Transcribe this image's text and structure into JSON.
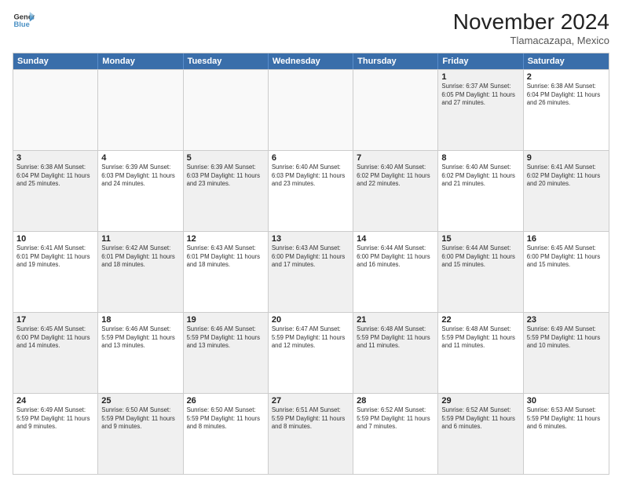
{
  "logo": {
    "line1": "General",
    "line2": "Blue",
    "icon": "▶"
  },
  "title": "November 2024",
  "location": "Tlamacazapa, Mexico",
  "header_days": [
    "Sunday",
    "Monday",
    "Tuesday",
    "Wednesday",
    "Thursday",
    "Friday",
    "Saturday"
  ],
  "weeks": [
    [
      {
        "day": "",
        "info": "",
        "empty": true
      },
      {
        "day": "",
        "info": "",
        "empty": true
      },
      {
        "day": "",
        "info": "",
        "empty": true
      },
      {
        "day": "",
        "info": "",
        "empty": true
      },
      {
        "day": "",
        "info": "",
        "empty": true
      },
      {
        "day": "1",
        "info": "Sunrise: 6:37 AM\nSunset: 6:05 PM\nDaylight: 11 hours and 27 minutes.",
        "shaded": true
      },
      {
        "day": "2",
        "info": "Sunrise: 6:38 AM\nSunset: 6:04 PM\nDaylight: 11 hours and 26 minutes.",
        "shaded": false
      }
    ],
    [
      {
        "day": "3",
        "info": "Sunrise: 6:38 AM\nSunset: 6:04 PM\nDaylight: 11 hours and 25 minutes.",
        "shaded": true
      },
      {
        "day": "4",
        "info": "Sunrise: 6:39 AM\nSunset: 6:03 PM\nDaylight: 11 hours and 24 minutes.",
        "shaded": false
      },
      {
        "day": "5",
        "info": "Sunrise: 6:39 AM\nSunset: 6:03 PM\nDaylight: 11 hours and 23 minutes.",
        "shaded": true
      },
      {
        "day": "6",
        "info": "Sunrise: 6:40 AM\nSunset: 6:03 PM\nDaylight: 11 hours and 23 minutes.",
        "shaded": false
      },
      {
        "day": "7",
        "info": "Sunrise: 6:40 AM\nSunset: 6:02 PM\nDaylight: 11 hours and 22 minutes.",
        "shaded": true
      },
      {
        "day": "8",
        "info": "Sunrise: 6:40 AM\nSunset: 6:02 PM\nDaylight: 11 hours and 21 minutes.",
        "shaded": false
      },
      {
        "day": "9",
        "info": "Sunrise: 6:41 AM\nSunset: 6:02 PM\nDaylight: 11 hours and 20 minutes.",
        "shaded": true
      }
    ],
    [
      {
        "day": "10",
        "info": "Sunrise: 6:41 AM\nSunset: 6:01 PM\nDaylight: 11 hours and 19 minutes.",
        "shaded": false
      },
      {
        "day": "11",
        "info": "Sunrise: 6:42 AM\nSunset: 6:01 PM\nDaylight: 11 hours and 18 minutes.",
        "shaded": true
      },
      {
        "day": "12",
        "info": "Sunrise: 6:43 AM\nSunset: 6:01 PM\nDaylight: 11 hours and 18 minutes.",
        "shaded": false
      },
      {
        "day": "13",
        "info": "Sunrise: 6:43 AM\nSunset: 6:00 PM\nDaylight: 11 hours and 17 minutes.",
        "shaded": true
      },
      {
        "day": "14",
        "info": "Sunrise: 6:44 AM\nSunset: 6:00 PM\nDaylight: 11 hours and 16 minutes.",
        "shaded": false
      },
      {
        "day": "15",
        "info": "Sunrise: 6:44 AM\nSunset: 6:00 PM\nDaylight: 11 hours and 15 minutes.",
        "shaded": true
      },
      {
        "day": "16",
        "info": "Sunrise: 6:45 AM\nSunset: 6:00 PM\nDaylight: 11 hours and 15 minutes.",
        "shaded": false
      }
    ],
    [
      {
        "day": "17",
        "info": "Sunrise: 6:45 AM\nSunset: 6:00 PM\nDaylight: 11 hours and 14 minutes.",
        "shaded": true
      },
      {
        "day": "18",
        "info": "Sunrise: 6:46 AM\nSunset: 5:59 PM\nDaylight: 11 hours and 13 minutes.",
        "shaded": false
      },
      {
        "day": "19",
        "info": "Sunrise: 6:46 AM\nSunset: 5:59 PM\nDaylight: 11 hours and 13 minutes.",
        "shaded": true
      },
      {
        "day": "20",
        "info": "Sunrise: 6:47 AM\nSunset: 5:59 PM\nDaylight: 11 hours and 12 minutes.",
        "shaded": false
      },
      {
        "day": "21",
        "info": "Sunrise: 6:48 AM\nSunset: 5:59 PM\nDaylight: 11 hours and 11 minutes.",
        "shaded": true
      },
      {
        "day": "22",
        "info": "Sunrise: 6:48 AM\nSunset: 5:59 PM\nDaylight: 11 hours and 11 minutes.",
        "shaded": false
      },
      {
        "day": "23",
        "info": "Sunrise: 6:49 AM\nSunset: 5:59 PM\nDaylight: 11 hours and 10 minutes.",
        "shaded": true
      }
    ],
    [
      {
        "day": "24",
        "info": "Sunrise: 6:49 AM\nSunset: 5:59 PM\nDaylight: 11 hours and 9 minutes.",
        "shaded": false
      },
      {
        "day": "25",
        "info": "Sunrise: 6:50 AM\nSunset: 5:59 PM\nDaylight: 11 hours and 9 minutes.",
        "shaded": true
      },
      {
        "day": "26",
        "info": "Sunrise: 6:50 AM\nSunset: 5:59 PM\nDaylight: 11 hours and 8 minutes.",
        "shaded": false
      },
      {
        "day": "27",
        "info": "Sunrise: 6:51 AM\nSunset: 5:59 PM\nDaylight: 11 hours and 8 minutes.",
        "shaded": true
      },
      {
        "day": "28",
        "info": "Sunrise: 6:52 AM\nSunset: 5:59 PM\nDaylight: 11 hours and 7 minutes.",
        "shaded": false
      },
      {
        "day": "29",
        "info": "Sunrise: 6:52 AM\nSunset: 5:59 PM\nDaylight: 11 hours and 6 minutes.",
        "shaded": true
      },
      {
        "day": "30",
        "info": "Sunrise: 6:53 AM\nSunset: 5:59 PM\nDaylight: 11 hours and 6 minutes.",
        "shaded": false
      }
    ]
  ]
}
